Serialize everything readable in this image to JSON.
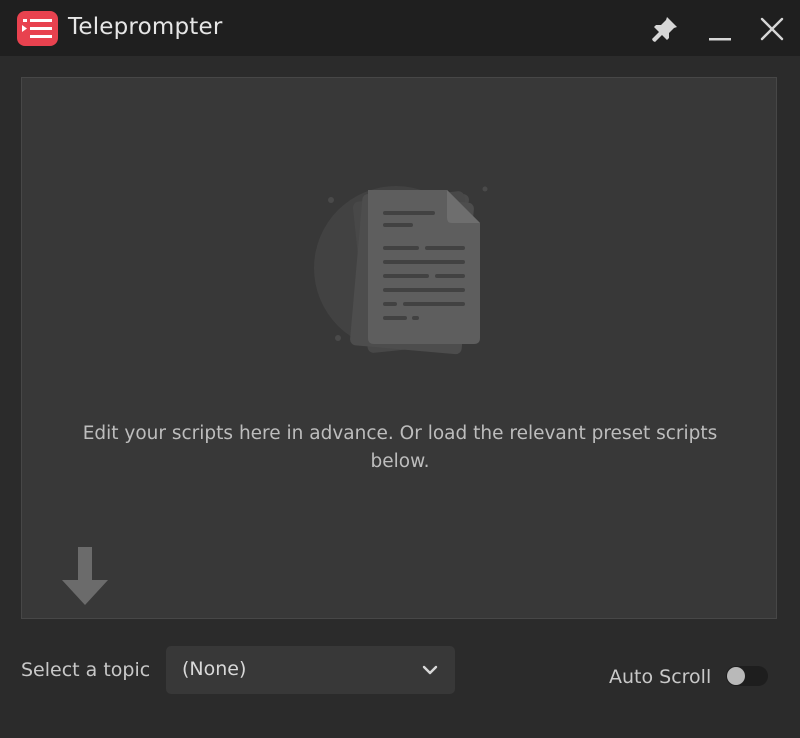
{
  "window": {
    "title": "Teleprompter",
    "logo_icon": "teleprompter-logo-icon",
    "controls": {
      "pin_icon": "pin-icon",
      "minimize_icon": "minimize-icon",
      "close_icon": "close-icon"
    }
  },
  "editor": {
    "illustration_icon": "document-icon",
    "hint": "Edit your scripts here in advance. Or load the relevant preset scripts below.",
    "arrow_icon": "arrow-down-icon"
  },
  "footer": {
    "topic_label": "Select a topic",
    "topic_value": "(None)",
    "dropdown_icon": "chevron-down-icon",
    "auto_scroll_label": "Auto Scroll",
    "auto_scroll_enabled": false
  },
  "colors": {
    "brand": "#e8424f",
    "titlebar": "#1f1f1f",
    "background": "#2b2b2b",
    "panel": "#383838"
  }
}
